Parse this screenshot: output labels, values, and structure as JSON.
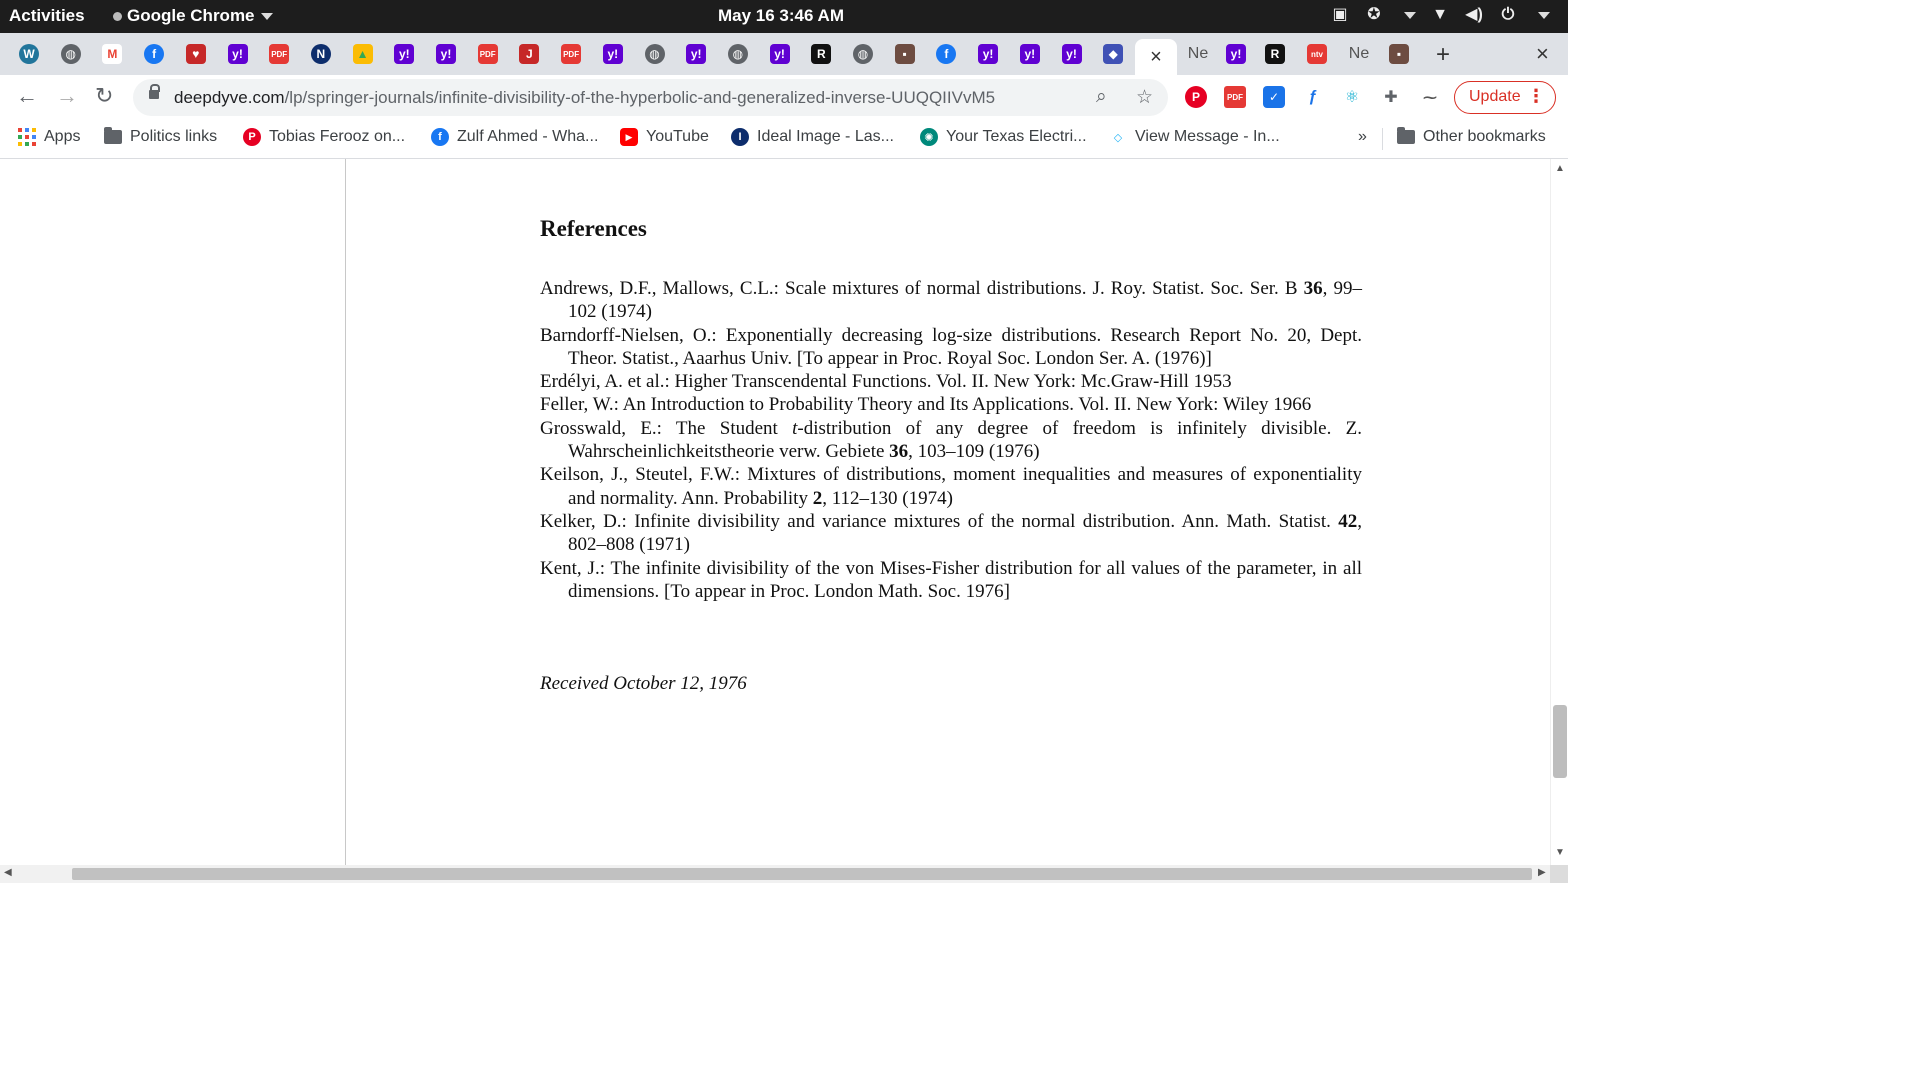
{
  "system_bar": {
    "activities": "Activities",
    "app_name": "Google Chrome",
    "clock": "May 16  3:46 AM"
  },
  "tabs": {
    "favicons": [
      "wordpress-icon",
      "globe-icon",
      "gmail-icon",
      "facebook-icon",
      "heart-icon",
      "yahoo-icon",
      "pdf-icon",
      "n-icon",
      "drive-icon",
      "yahoo-icon",
      "yahoo-icon",
      "pdf-icon",
      "j-icon",
      "pdf-icon",
      "yahoo-icon",
      "globe-icon",
      "yahoo-icon",
      "globe-icon",
      "yahoo-icon",
      "r-icon",
      "globe-icon",
      "photo-icon",
      "facebook-icon",
      "yahoo-icon",
      "yahoo-icon",
      "yahoo-icon",
      "deepdyve-icon"
    ],
    "active_close": "×",
    "after_active": [
      {
        "icon": "",
        "text": "Ne"
      },
      {
        "icon": "yahoo-icon",
        "text": ""
      },
      {
        "icon": "r-icon",
        "text": ""
      },
      {
        "icon": "ntv-icon",
        "text": ""
      },
      {
        "icon": "",
        "text": "Ne"
      },
      {
        "icon": "photo-icon",
        "text": ""
      }
    ],
    "new_tab": "+",
    "close_window": "×"
  },
  "toolbar": {
    "url_host": "deepdyve.com",
    "url_path": "/lp/springer-journals/infinite-divisibility-of-the-hyperbolic-and-generalized-inverse-UUQQIIVvM5",
    "update_label": "Update"
  },
  "bookmarks": {
    "apps": "Apps",
    "items": [
      {
        "label": "Politics links",
        "icon": "folder-icon"
      },
      {
        "label": "Tobias Ferooz on...",
        "icon": "pinterest-icon"
      },
      {
        "label": "Zulf Ahmed - Wha...",
        "icon": "facebook-icon"
      },
      {
        "label": "YouTube",
        "icon": "youtube-icon"
      },
      {
        "label": "Ideal Image - Las...",
        "icon": "ideal-image-icon"
      },
      {
        "label": "Your Texas Electri...",
        "icon": "texas-electric-icon"
      },
      {
        "label": "View Message - In...",
        "icon": "message-icon"
      }
    ],
    "overflow": "»",
    "other": "Other bookmarks"
  },
  "document": {
    "heading": "References",
    "references": [
      [
        {
          "t": "Andrews, D.F., Mallows, C.L.: Scale mixtures of normal distributions. J. Roy. Statist. Soc. Ser. B "
        },
        {
          "t": "36",
          "b": true
        },
        {
          "t": ", 99–102 (1974)"
        }
      ],
      [
        {
          "t": "Barndorff-Nielsen, O.: Exponentially decreasing log-size distributions. Research Report No. 20, Dept. Theor. Statist., Aaarhus Univ. [To appear in Proc. Royal Soc. London Ser. A. (1976)]"
        }
      ],
      [
        {
          "t": "Erdélyi, A. et al.: Higher Transcendental Functions. Vol. II. New York: Mc.Graw-Hill 1953"
        }
      ],
      [
        {
          "t": "Feller, W.: An Introduction to Probability Theory and Its Applications. Vol. II. New York: Wiley 1966"
        }
      ],
      [
        {
          "t": "Grosswald, E.: The Student "
        },
        {
          "t": "t",
          "i": true
        },
        {
          "t": "-distribution of any degree of freedom is infinitely divisible. Z. Wahrscheinlichkeitstheorie verw. Gebiete "
        },
        {
          "t": "36",
          "b": true
        },
        {
          "t": ", 103–109 (1976)"
        }
      ],
      [
        {
          "t": "Keilson, J., Steutel, F.W.: Mixtures of distributions, moment inequalities and measures of exponentiality and normality. Ann. Probability "
        },
        {
          "t": "2",
          "b": true
        },
        {
          "t": ", 112–130 (1974)"
        }
      ],
      [
        {
          "t": "Kelker, D.: Infinite divisibility and variance mixtures of the normal distribution. Ann. Math. Statist. "
        },
        {
          "t": "42",
          "b": true
        },
        {
          "t": ", 802–808 (1971)"
        }
      ],
      [
        {
          "t": "Kent, J.: The infinite divisibility of the von Mises-Fisher distribution for all values of the parameter, in all dimensions. [To appear in Proc. London Math. Soc. 1976]"
        }
      ]
    ],
    "received": "Received October 12, 1976"
  },
  "colors": {
    "topbar": "#1d1d1d",
    "tabstrip": "#dee1e6",
    "yahoo": "#6001d2",
    "update_red": "#d93025"
  }
}
